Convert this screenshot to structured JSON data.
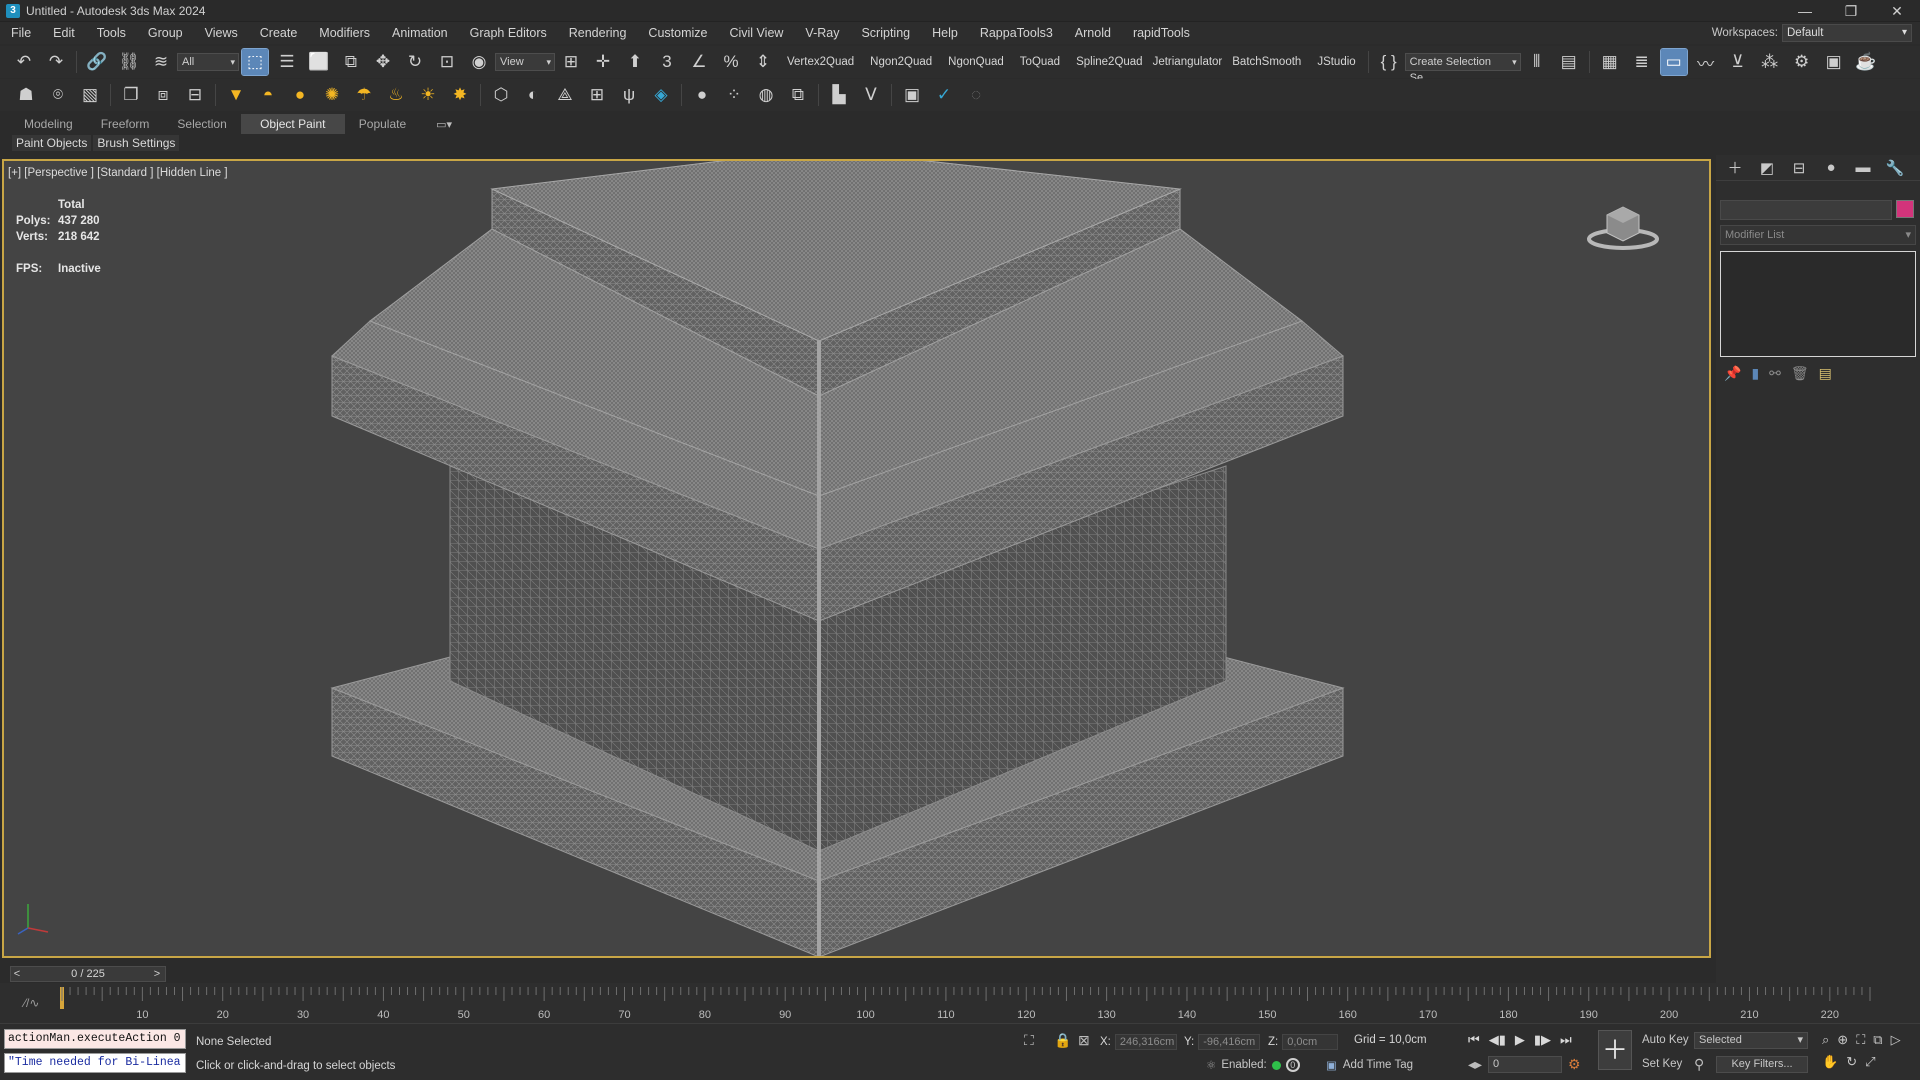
{
  "window": {
    "title": "Untitled - Autodesk 3ds Max 2024",
    "app_icon": "3",
    "controls": [
      "—",
      "❐",
      "✕"
    ]
  },
  "menu": {
    "items": [
      "File",
      "Edit",
      "Tools",
      "Group",
      "Views",
      "Create",
      "Modifiers",
      "Animation",
      "Graph Editors",
      "Rendering",
      "Customize",
      "Civil View",
      "V-Ray",
      "Scripting",
      "Help",
      "RappaTools3",
      "Arnold",
      "rapidTools"
    ],
    "workspace_label": "Workspaces:",
    "workspace_value": "Default"
  },
  "toolbar1": {
    "filter_value": "All",
    "ref_coord_value": "View",
    "script_buttons": [
      "Vertex2Quad",
      "Ngon2Quad",
      "NgonQuad",
      "ToQuad",
      "Spline2Quad",
      "Jetriangulator",
      "BatchSmooth",
      "JStudio"
    ],
    "named_selection_value": "Create Selection Se"
  },
  "ribbon": {
    "tabs": [
      "Modeling",
      "Freeform",
      "Selection",
      "Object Paint",
      "Populate"
    ],
    "active_tab": "Object Paint",
    "subtabs": [
      "Paint Objects",
      "Brush Settings"
    ]
  },
  "viewport": {
    "label": "[+] [Perspective ] [Standard ] [Hidden Line ]",
    "stats": {
      "total_label": "Total",
      "polys_label": "Polys:",
      "polys_value": "437 280",
      "verts_label": "Verts:",
      "verts_value": "218 642",
      "fps_label": "FPS:",
      "fps_value": "Inactive"
    },
    "colors": {
      "border_active": "#c8a646",
      "background": "#444444",
      "wire": "#8a8a8a"
    }
  },
  "command_panel": {
    "modifier_list_placeholder": "Modifier List",
    "object_color": "#d3347b"
  },
  "timeline": {
    "slider_label": "0 / 225",
    "prev": "<",
    "next": ">",
    "ticks": [
      10,
      20,
      30,
      40,
      50,
      60,
      70,
      80,
      90,
      100,
      110,
      120,
      130,
      140,
      150,
      160,
      170,
      180,
      190,
      200,
      210,
      220
    ],
    "max_frame": 225
  },
  "status": {
    "listener_line1": "actionMan.executeAction 0",
    "listener_line2": "\"Time needed for Bi-Linea",
    "selection_text": "None Selected",
    "prompt_text": "Click or click-and-drag to select objects",
    "x_label": "X:",
    "x_value": "246,316cm",
    "y_label": "Y:",
    "y_value": "-96,416cm",
    "z_label": "Z:",
    "z_value": "0,0cm",
    "grid_text": "Grid = 10,0cm",
    "enabled_label": "Enabled:",
    "add_time_tag": "Add Time Tag",
    "auto_key": "Auto Key",
    "set_key": "Set Key",
    "selected_value": "Selected",
    "frame_value": "0",
    "key_filters": "Key Filters..."
  }
}
